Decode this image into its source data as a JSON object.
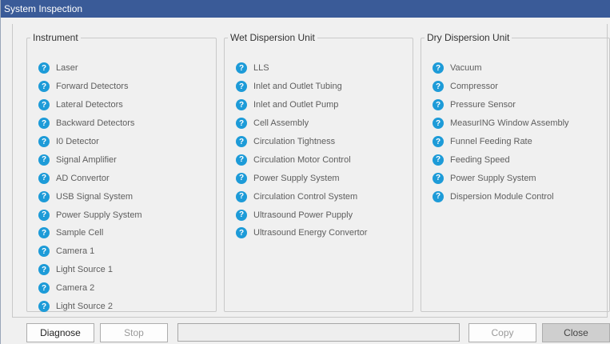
{
  "window": {
    "title": "System Inspection"
  },
  "groups": [
    {
      "title": "Instrument",
      "items": [
        "Laser",
        "Forward Detectors",
        "Lateral Detectors",
        "Backward Detectors",
        "I0 Detector",
        "Signal Amplifier",
        "AD Convertor",
        "USB Signal System",
        "Power Supply System",
        "Sample Cell",
        "Camera 1",
        "Light Source 1",
        "Camera 2",
        "Light Source 2"
      ]
    },
    {
      "title": "Wet Dispersion Unit",
      "items": [
        "LLS",
        "Inlet and Outlet Tubing",
        "Inlet and Outlet Pump",
        "Cell Assembly",
        "Circulation Tightness",
        "Circulation Motor Control",
        "Power Supply System",
        "Circulation Control System",
        "Ultrasound Power Pupply",
        "Ultrasound Energy Convertor"
      ]
    },
    {
      "title": "Dry Dispersion Unit",
      "items": [
        "Vacuum",
        "Compressor",
        "Pressure Sensor",
        "MeasurING Window Assembly",
        "Funnel Feeding Rate",
        "Feeding Speed",
        "Power Supply System",
        "Dispersion Module Control"
      ]
    }
  ],
  "status_icon": {
    "name": "question-mark-icon",
    "glyph": "?",
    "color": "#1d9bd8"
  },
  "buttons": {
    "diagnose": "Diagnose",
    "stop": "Stop",
    "copy": "Copy",
    "close": "Close"
  },
  "progress": {
    "value": 0
  }
}
